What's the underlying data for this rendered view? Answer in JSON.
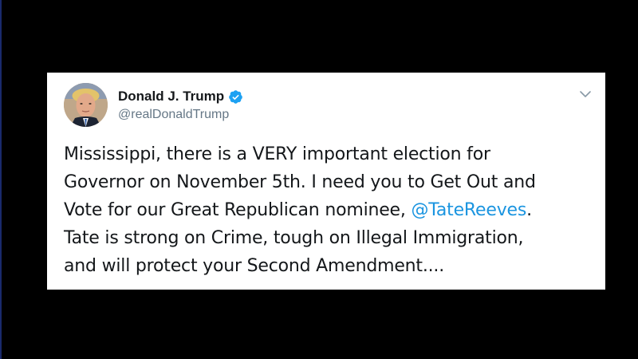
{
  "tweet": {
    "author_name": "Donald J. Trump",
    "author_handle": "@realDonaldTrump",
    "verified": true,
    "text_line1": "Mississippi, there is a VERY important election for",
    "text_line2": "Governor on November 5th. I need you to Get Out and",
    "text_line3_before": "Vote for our Great Republican nominee, ",
    "mention": "@TateReeves",
    "text_line3_after": ".",
    "text_line4": "Tate is strong on Crime, tough on Illegal Immigration,",
    "text_line5": "and will protect your Second Amendment...."
  },
  "icons": {
    "verified": "verified-badge-icon",
    "menu": "chevron-down-icon"
  },
  "colors": {
    "background": "#000000",
    "card": "#ffffff",
    "text": "#14171a",
    "handle": "#657786",
    "link": "#1b95e0",
    "verified": "#1da1f2"
  }
}
